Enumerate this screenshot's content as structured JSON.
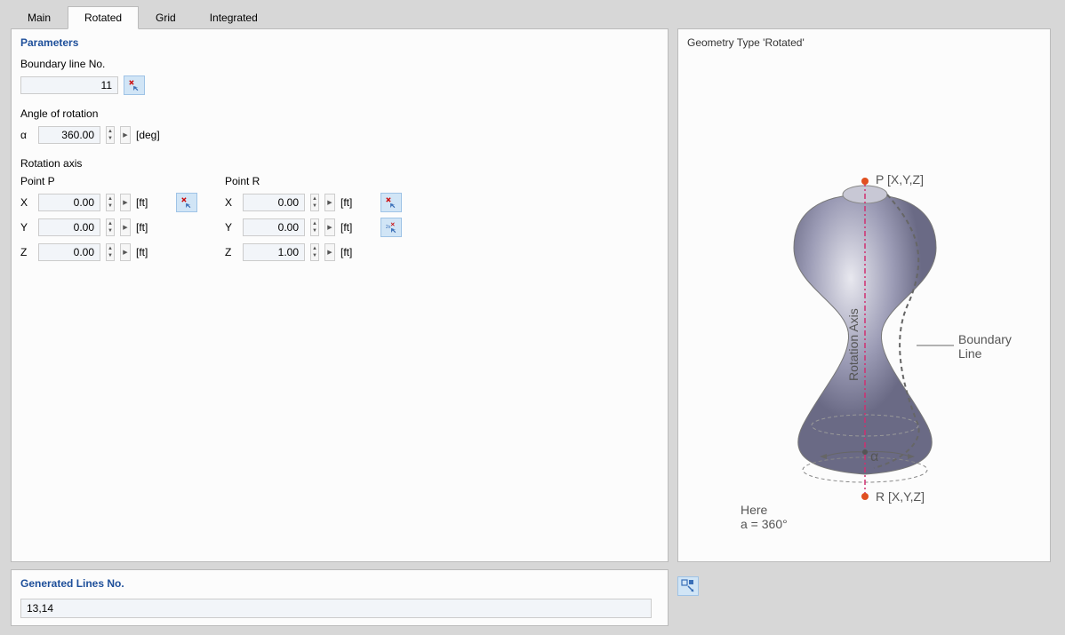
{
  "tabs": {
    "main": "Main",
    "rotated": "Rotated",
    "grid": "Grid",
    "integrated": "Integrated",
    "active": "rotated"
  },
  "parameters": {
    "title": "Parameters",
    "boundary_label": "Boundary line No.",
    "boundary_value": "11",
    "angle_label": "Angle of rotation",
    "angle_symbol": "α",
    "angle_value": "360.00",
    "angle_unit": "[deg]",
    "rotation_axis_label": "Rotation axis",
    "point_p_label": "Point P",
    "point_r_label": "Point R",
    "coords": {
      "p": {
        "x": "0.00",
        "y": "0.00",
        "z": "0.00"
      },
      "r": {
        "x": "0.00",
        "y": "0.00",
        "z": "1.00"
      }
    },
    "coord_unit": "[ft]",
    "axis_x": "X",
    "axis_y": "Y",
    "axis_z": "Z"
  },
  "generated": {
    "title": "Generated Lines No.",
    "value": "13,14"
  },
  "preview": {
    "title": "Geometry Type 'Rotated'",
    "label_p": "P [X,Y,Z]",
    "label_r": "R [X,Y,Z]",
    "label_axis": "Rotation Axis",
    "label_boundary": "Boundary\nLine",
    "label_alpha": "α",
    "label_here": "Here\na = 360°"
  }
}
